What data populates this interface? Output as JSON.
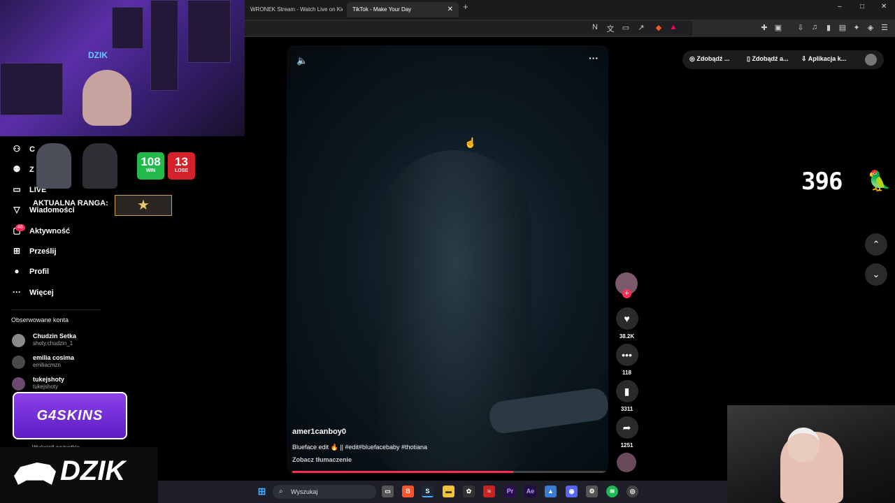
{
  "browser": {
    "tabs": [
      {
        "label": "WRONEK Stream - Watch Live on Kick"
      },
      {
        "label": "TikTok - Make Your Day"
      }
    ],
    "new_tab": "+",
    "window_controls": {
      "minimize": "–",
      "maximize": "□",
      "close": "✕"
    }
  },
  "sidebar": {
    "items": [
      {
        "label": "C",
        "icon": "person-check-icon"
      },
      {
        "label": "Z",
        "icon": "people-icon"
      },
      {
        "label": "LIVE",
        "icon": "tv-icon"
      },
      {
        "label": "Wiadomości",
        "icon": "send-icon"
      },
      {
        "label": "Aktywność",
        "icon": "bell-icon",
        "badge": "46"
      },
      {
        "label": "Prześlij",
        "icon": "plus-square-icon"
      },
      {
        "label": "Profil",
        "icon": "avatar-icon"
      },
      {
        "label": "Więcej",
        "icon": "ellipsis-icon"
      }
    ],
    "followed_title": "Obserwowane konta",
    "followed": [
      {
        "name": "Chudzin Setka",
        "handle": "shoty.chudzin_1"
      },
      {
        "name": "emilia cosima",
        "handle": "emiliacmzn"
      },
      {
        "name": "tukejshoty",
        "handle": "tukejshoty"
      }
    ],
    "see_all": "Wyświetl wszystkie"
  },
  "overlay": {
    "win_count": "108",
    "win_label": "WIN",
    "lose_count": "13",
    "lose_label": "LOSE",
    "rank_label": "AKTUALNA RANGA:",
    "sponsor_g4": "G4SKINS",
    "sponsor_dzik": "DZIK",
    "dzik_sign": "DZIK",
    "counter": "396"
  },
  "video": {
    "author": "amer1canboy0",
    "caption": "Blueface edit 🔥 || #edit#bluefacebaby #thotiana",
    "translate": "Zobacz tłumaczenie",
    "progress": 0.7,
    "likes": "38.2K",
    "comments": "118",
    "saves": "3311",
    "shares": "1251"
  },
  "topbar": {
    "pill1": "Zdobądź ...",
    "pill2": "Zdobądź a...",
    "pill3": "Aplikacja k..."
  },
  "taskbar": {
    "search_placeholder": "Wyszukaj"
  },
  "colors": {
    "accent": "#fe2c55",
    "win": "#23b84c",
    "lose": "#d4222d",
    "g4": "#7b35dc"
  }
}
